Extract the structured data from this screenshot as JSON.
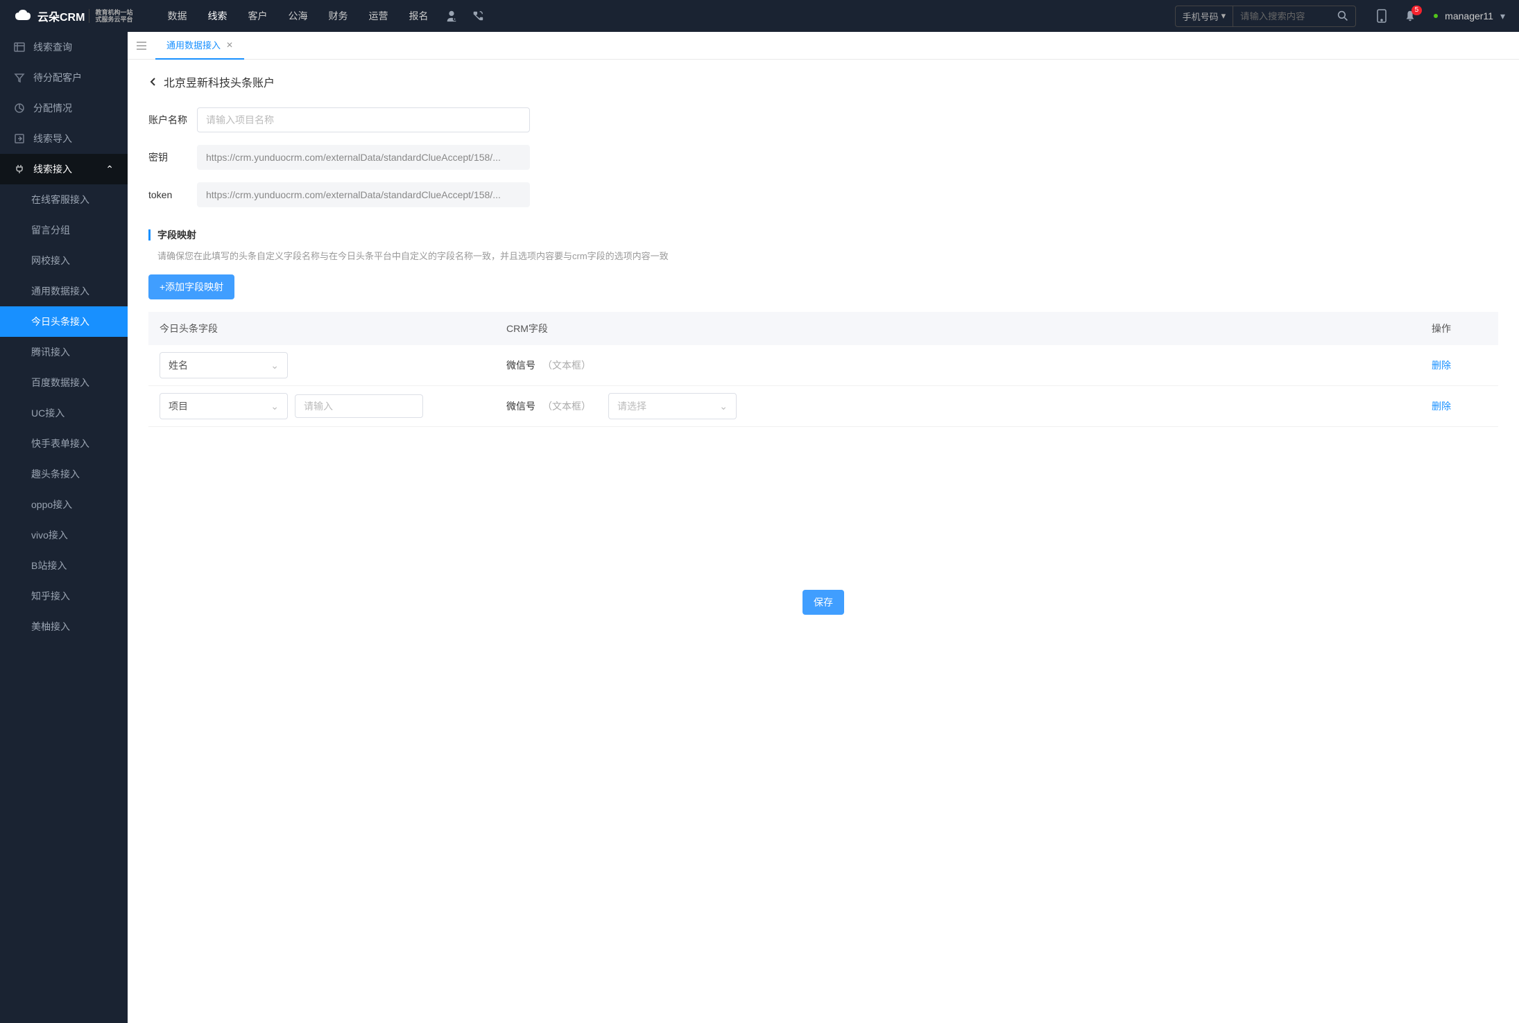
{
  "topbar": {
    "logo_text": "云朵CRM",
    "logo_sub1": "教育机构一站",
    "logo_sub2": "式服务云平台",
    "nav": [
      "数据",
      "线索",
      "客户",
      "公海",
      "财务",
      "运营",
      "报名"
    ],
    "nav_active": "线索",
    "search_type": "手机号码",
    "search_placeholder": "请输入搜索内容",
    "badge": "5",
    "user": "manager11"
  },
  "sidebar": {
    "items": [
      {
        "label": "线索查询",
        "icon": "list"
      },
      {
        "label": "待分配客户",
        "icon": "filter"
      },
      {
        "label": "分配情况",
        "icon": "pie"
      },
      {
        "label": "线索导入",
        "icon": "export"
      },
      {
        "label": "线索接入",
        "icon": "plug",
        "expanded": true,
        "children": [
          {
            "label": "在线客服接入"
          },
          {
            "label": "留言分组"
          },
          {
            "label": "网校接入"
          },
          {
            "label": "通用数据接入"
          },
          {
            "label": "今日头条接入",
            "active": true
          },
          {
            "label": "腾讯接入"
          },
          {
            "label": "百度数据接入"
          },
          {
            "label": "UC接入"
          },
          {
            "label": "快手表单接入"
          },
          {
            "label": "趣头条接入"
          },
          {
            "label": "oppo接入"
          },
          {
            "label": "vivo接入"
          },
          {
            "label": "B站接入"
          },
          {
            "label": "知乎接入"
          },
          {
            "label": "美柚接入"
          }
        ]
      }
    ]
  },
  "tabs": {
    "items": [
      {
        "label": "通用数据接入",
        "active": true
      }
    ]
  },
  "page": {
    "title": "北京昱新科技头条账户",
    "form": {
      "account_label": "账户名称",
      "account_placeholder": "请输入项目名称",
      "secret_label": "密钥",
      "secret_value": "https://crm.yunduocrm.com/externalData/standardClueAccept/158/...",
      "token_label": "token",
      "token_value": "https://crm.yunduocrm.com/externalData/standardClueAccept/158/..."
    },
    "mapping": {
      "title": "字段映射",
      "desc": "请确保您在此填写的头条自定义字段名称与在今日头条平台中自定义的字段名称一致，并且选项内容要与crm字段的选项内容一致",
      "add_btn": "+添加字段映射",
      "columns": {
        "c1": "今日头条字段",
        "c2": "CRM字段",
        "c3": "操作"
      },
      "rows": [
        {
          "tt_field": "姓名",
          "crm_field": "微信号",
          "crm_type": "（文本框）",
          "del": "删除"
        },
        {
          "tt_field": "项目",
          "extra_placeholder": "请输入",
          "crm_field": "微信号",
          "crm_type": "（文本框）",
          "sel_placeholder": "请选择",
          "del": "删除"
        }
      ]
    },
    "save_btn": "保存"
  }
}
